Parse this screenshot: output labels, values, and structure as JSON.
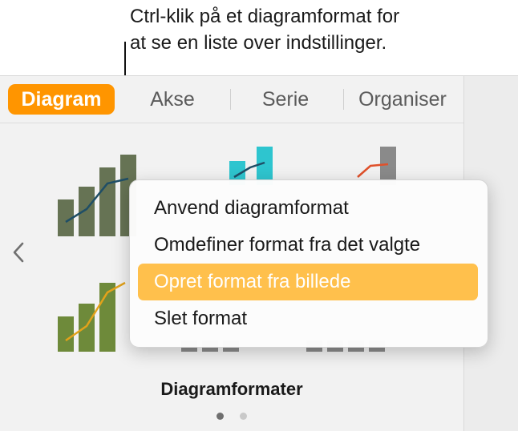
{
  "callout": {
    "line1": "Ctrl-klik på et diagramformat for",
    "line2": "at se en liste over indstillinger."
  },
  "tabs": [
    {
      "label": "Diagram",
      "active": true
    },
    {
      "label": "Akse",
      "active": false
    },
    {
      "label": "Serie",
      "active": false
    },
    {
      "label": "Organiser",
      "active": false
    }
  ],
  "context_menu": {
    "items": [
      {
        "label": "Anvend diagramformat",
        "highlighted": false
      },
      {
        "label": "Omdefiner format fra det valgte",
        "highlighted": false
      },
      {
        "label": "Opret format fra billede",
        "highlighted": true
      },
      {
        "label": "Slet format",
        "highlighted": false
      }
    ]
  },
  "section_title": "Diagramformater",
  "page_indicator": {
    "pages": 2,
    "current": 1
  },
  "icons": {
    "prev": "chevron-left-icon"
  },
  "colors": {
    "accent": "#ff9500",
    "highlight": "#ffc04c"
  }
}
